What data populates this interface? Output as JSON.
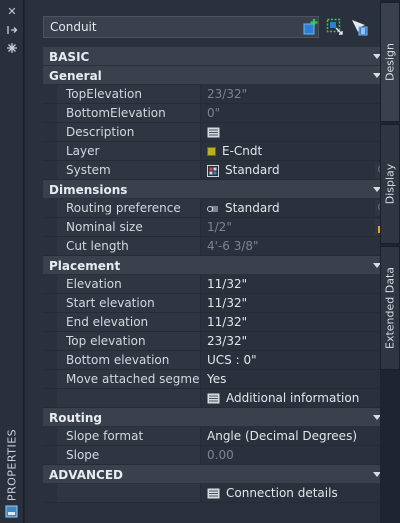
{
  "palette": {
    "top_elevation_bg": "#2b313c",
    "layer_color": "#b8b21e",
    "accent": "#1e90d8"
  },
  "palette_title": "PROPERTIES",
  "selector": {
    "value": "Conduit"
  },
  "toolbar": {
    "icons": [
      "quick-select-icon",
      "select-objects-icon",
      "toggle-pickadd-icon"
    ]
  },
  "tabs": [
    "Design",
    "Display",
    "Extended Data"
  ],
  "basic": {
    "label": "BASIC",
    "general": {
      "label": "General",
      "rows": [
        {
          "name": "TopElevation",
          "value": "23/32\""
        },
        {
          "name": "BottomElevation",
          "value": "0\""
        },
        {
          "name": "Description",
          "value": ""
        },
        {
          "name": "Layer",
          "value": "E-Cndt"
        },
        {
          "name": "System",
          "value": "Standard"
        }
      ]
    },
    "dimensions": {
      "label": "Dimensions",
      "rows": [
        {
          "name": "Routing preference",
          "value": "Standard"
        },
        {
          "name": "Nominal size",
          "value": "1/2\""
        },
        {
          "name": "Cut length",
          "value": "4'-6 3/8\""
        }
      ]
    },
    "placement": {
      "label": "Placement",
      "rows": [
        {
          "name": "Elevation",
          "value": "11/32\""
        },
        {
          "name": "Start elevation",
          "value": "11/32\""
        },
        {
          "name": "End elevation",
          "value": "11/32\""
        },
        {
          "name": "Top elevation",
          "value": "23/32\""
        },
        {
          "name": "Bottom elevation",
          "value": "UCS : 0\""
        },
        {
          "name": "Move attached segme...",
          "value": "Yes"
        },
        {
          "name": "",
          "value": "Additional information"
        }
      ]
    },
    "routing": {
      "label": "Routing",
      "rows": [
        {
          "name": "Slope format",
          "value": "Angle (Decimal Degrees)"
        },
        {
          "name": "Slope",
          "value": "0.00"
        }
      ]
    }
  },
  "advanced": {
    "label": "ADVANCED",
    "connection_details": "Connection details"
  }
}
